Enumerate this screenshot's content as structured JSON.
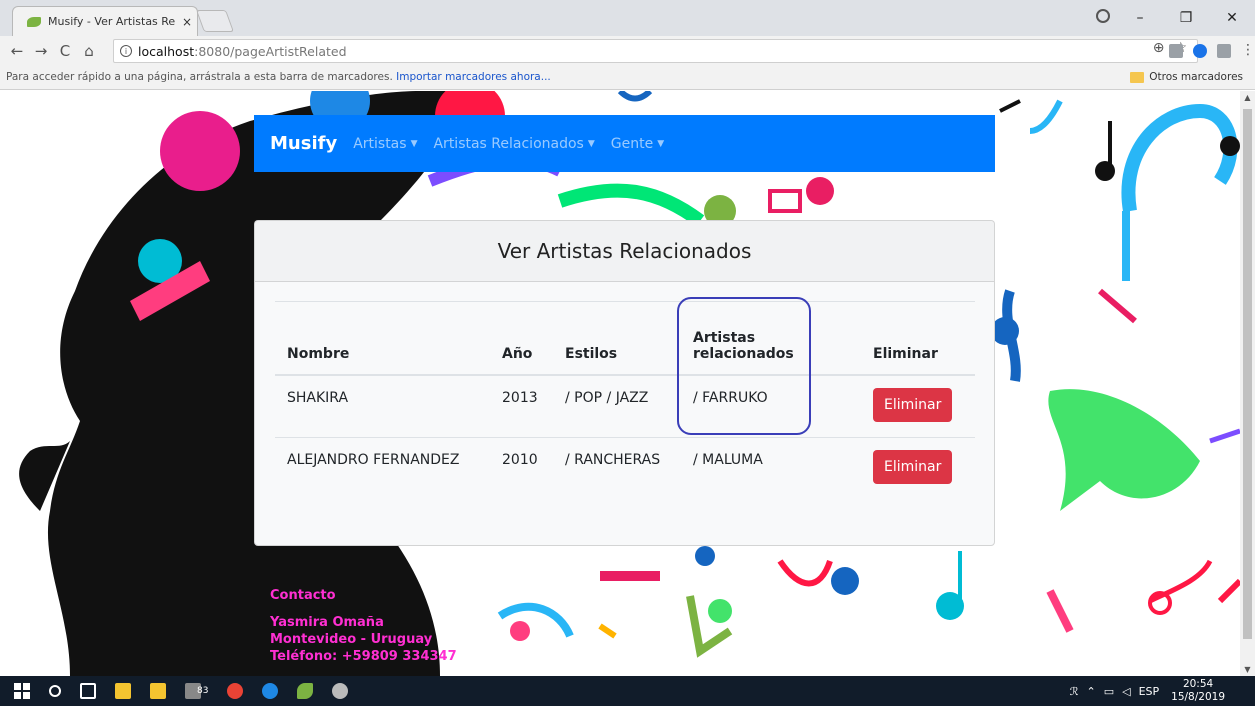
{
  "browser": {
    "tab_title": "Musify - Ver Artistas Rela",
    "tab_close": "×",
    "url_host": "localhost",
    "url_path": ":8080/pageArtistRelated",
    "bookmarks_hint": "Para acceder rápido a una página, arrástrala a esta barra de marcadores.",
    "bookmarks_import": "Importar marcadores ahora...",
    "other_bookmarks": "Otros marcadores",
    "back": "←",
    "forward": "→",
    "reload": "C",
    "home": "⌂",
    "zoom_icon": "⊕",
    "star_icon": "☆",
    "minimize": "–",
    "maximize": "❐",
    "close": "✕"
  },
  "navbar": {
    "brand": "Musify",
    "items": [
      {
        "label": "Artistas"
      },
      {
        "label": "Artistas Relacionados"
      },
      {
        "label": "Gente"
      }
    ],
    "caret": "▼"
  },
  "card": {
    "title": "Ver Artistas Relacionados",
    "columns": [
      "Nombre",
      "Año",
      "Estilos",
      "Artistas relacionados",
      "Eliminar"
    ],
    "rows": [
      {
        "nombre": "SHAKIRA",
        "anio": "2013",
        "estilos": "/ POP / JAZZ",
        "relacionados": "/ FARRUKO",
        "action": "Eliminar"
      },
      {
        "nombre": "ALEJANDRO FERNANDEZ",
        "anio": "2010",
        "estilos": "/ RANCHERAS",
        "relacionados": "/ MALUMA",
        "action": "Eliminar"
      }
    ]
  },
  "contact": {
    "heading": "Contacto",
    "name": "Yasmira Omaña",
    "city": "Montevideo - Uruguay",
    "phone": "Teléfono: +59809 334347"
  },
  "taskbar": {
    "badge": "83",
    "lang": "ESP",
    "time": "20:54",
    "date": "15/8/2019"
  },
  "colors": {
    "navbar": "#007bff",
    "danger": "#dc3545",
    "contact": "#ff2fd2",
    "highlight": "#3a3eb8"
  }
}
